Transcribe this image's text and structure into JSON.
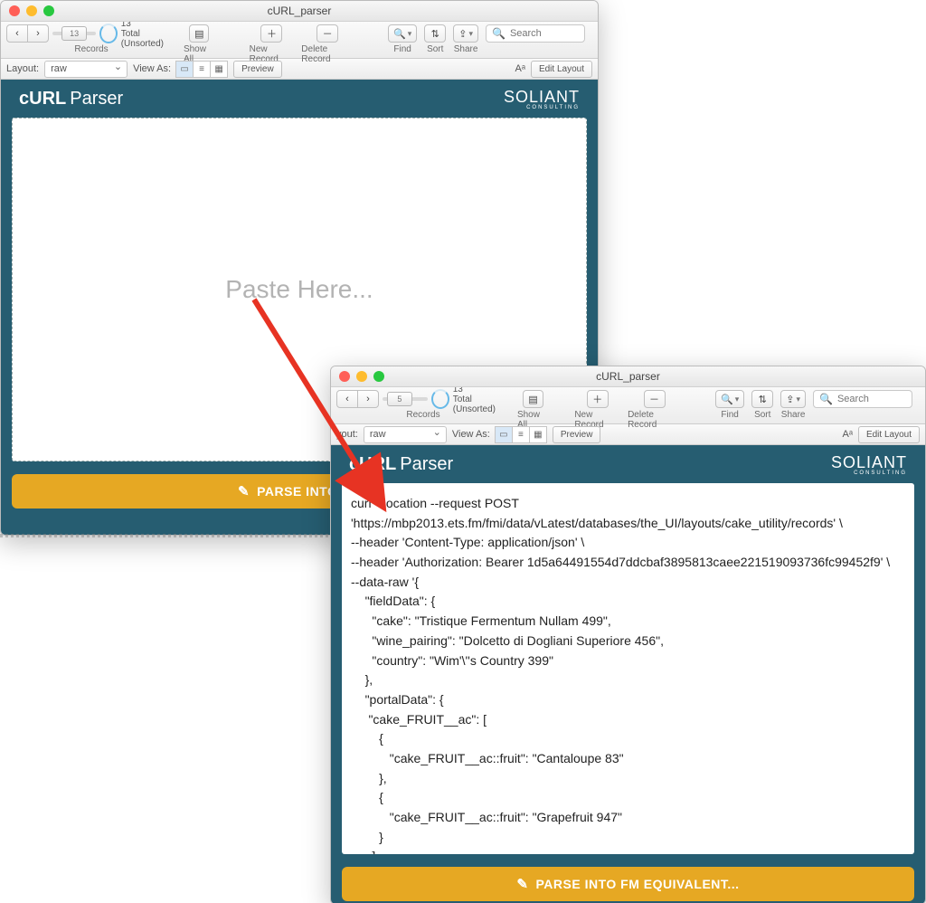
{
  "window1": {
    "title": "cURL_parser",
    "record_pos": "13",
    "record_count": "13",
    "record_filter": "Total (Unsorted)",
    "toolbar": {
      "records": "Records",
      "showall": "Show All",
      "newrecord": "New Record",
      "deleterecord": "Delete Record",
      "find": "Find",
      "sort": "Sort",
      "share": "Share",
      "search_ph": "Search"
    },
    "statusbar": {
      "layout_label": "Layout:",
      "layout_value": "raw",
      "viewas": "View As:",
      "preview": "Preview",
      "aa": "Aᵃ",
      "editlayout": "Edit Layout"
    },
    "app": {
      "title_bold": "cURL",
      "title_light": "Parser",
      "logo": "SOLIANT",
      "logo_sub": "CONSULTING",
      "paste_ph": "Paste Here...",
      "parse_btn": "PARSE INTO FM"
    }
  },
  "window2": {
    "title": "cURL_parser",
    "record_pos": "5",
    "record_count": "13",
    "record_filter": "Total (Unsorted)",
    "toolbar": {
      "records": "Records",
      "showall": "Show All",
      "newrecord": "New Record",
      "deleterecord": "Delete Record",
      "find": "Find",
      "sort": "Sort",
      "share": "Share",
      "search_ph": "Search"
    },
    "statusbar": {
      "layout_label": "yout:",
      "layout_value": "raw",
      "viewas": "View As:",
      "preview": "Preview",
      "aa": "Aᵃ",
      "editlayout": "Edit Layout"
    },
    "app": {
      "title_bold": "cURL",
      "title_light": "Parser",
      "logo": "SOLIANT",
      "logo_sub": "CONSULTING",
      "codebox": "curl --location --request POST 'https://mbp2013.ets.fm/fmi/data/vLatest/databases/the_UI/layouts/cake_utility/records' \\\n--header 'Content-Type: application/json' \\\n--header 'Authorization: Bearer 1d5a64491554d7ddcbaf3895813caee221519093736fc99452f9' \\\n--data-raw '{\n    \"fieldData\": {\n      \"cake\": \"Tristique Fermentum Nullam 499\",\n      \"wine_pairing\": \"Dolcetto di Dogliani Superiore 456\",\n      \"country\": \"Wim'\\''s Country 399\"\n    },\n    \"portalData\": {\n     \"cake_FRUIT__ac\": [\n        {\n           \"cake_FRUIT__ac::fruit\": \"Cantaloupe 83\"\n        },\n        {\n           \"cake_FRUIT__ac::fruit\": \"Grapefruit 947\"\n        }\n      ]\n    },\n    \"script\": \"log\",\n    \"script.param\": \"after\",\n    \"script.prerequest\": \"log\",\n    \"script.prerequest.param\": \"before\",",
      "parse_btn": "PARSE INTO FM EQUIVALENT..."
    }
  }
}
